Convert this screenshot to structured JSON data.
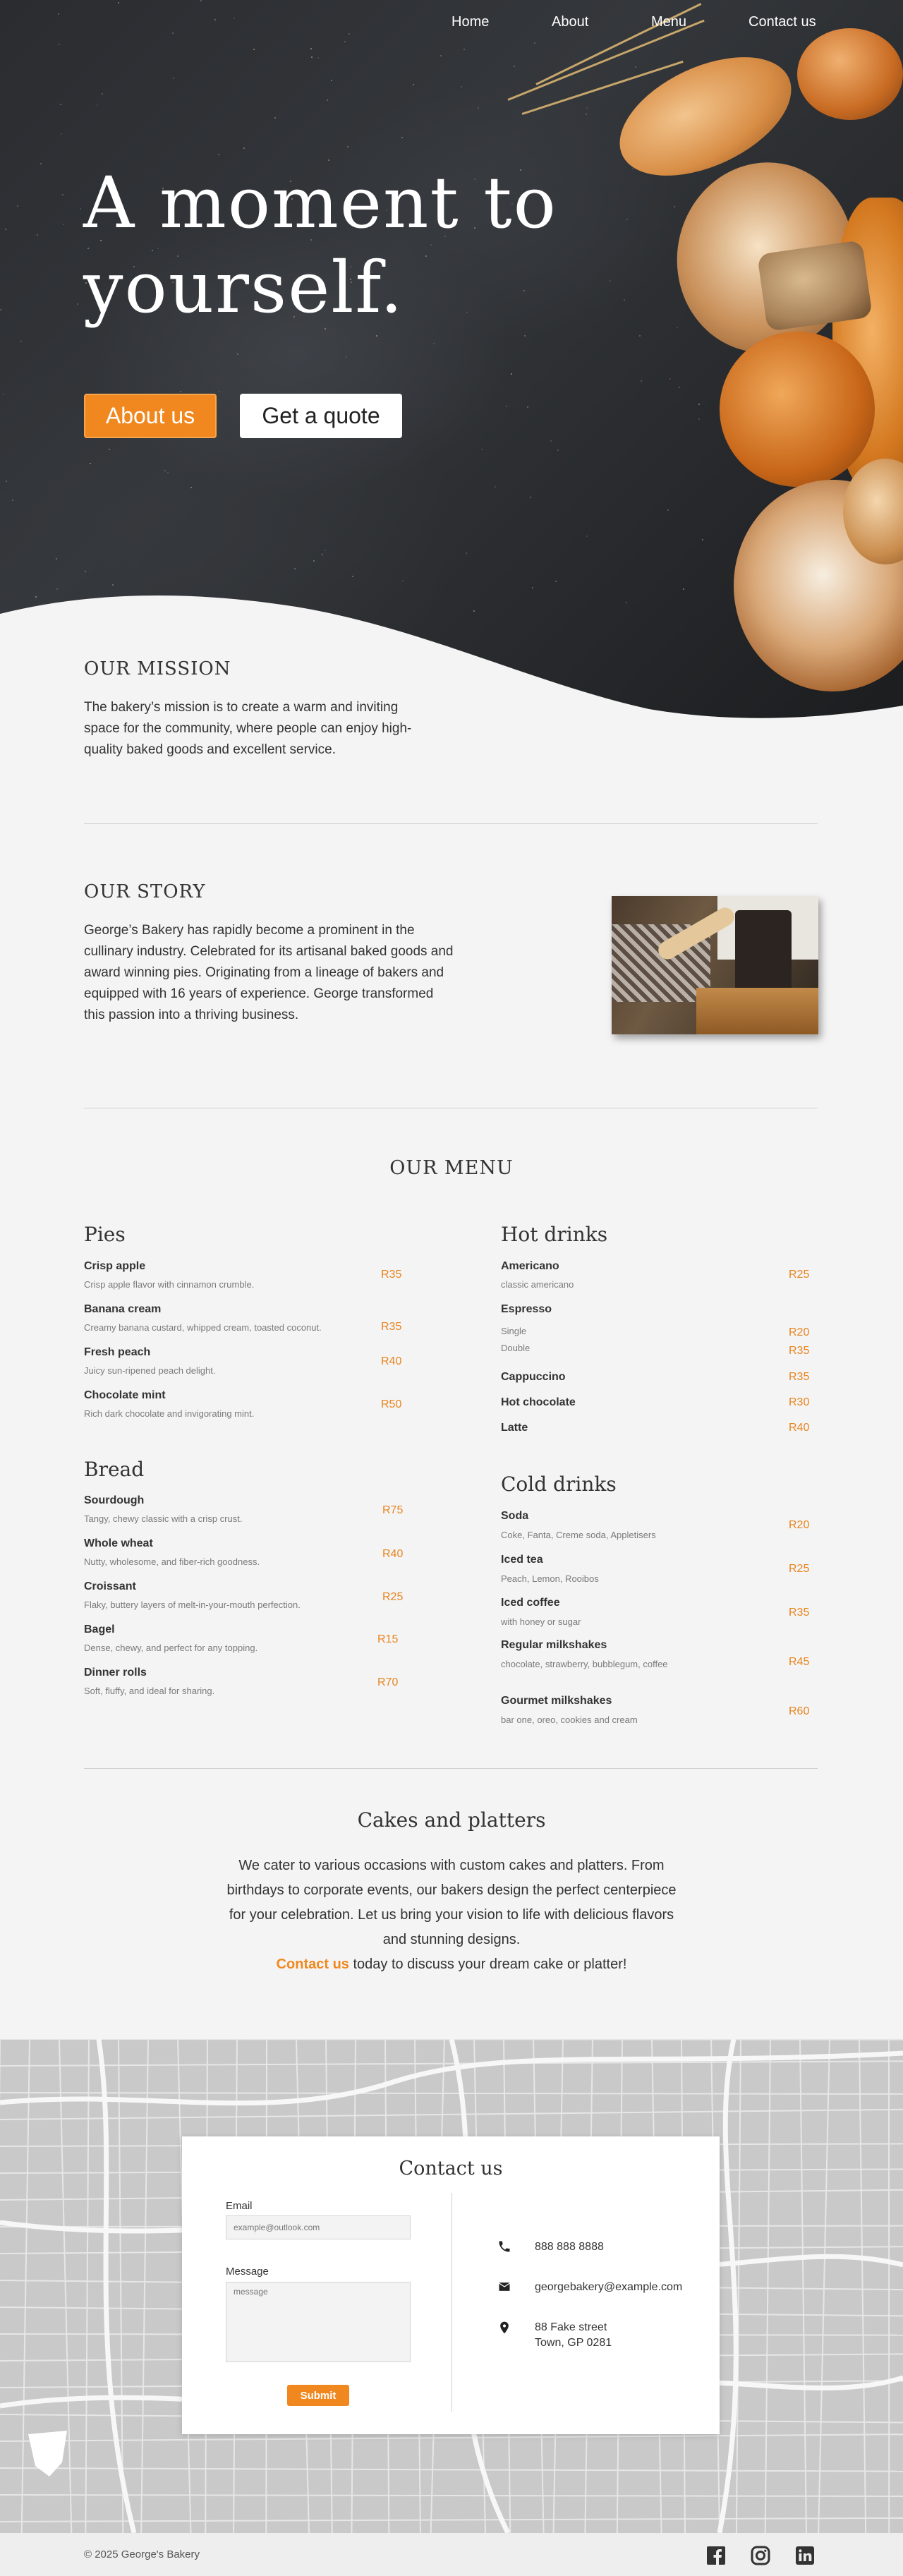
{
  "nav": {
    "items": [
      {
        "label": "Home"
      },
      {
        "label": "About"
      },
      {
        "label": "Menu"
      },
      {
        "label": "Contact us"
      }
    ]
  },
  "hero": {
    "title_line1": "A moment to",
    "title_line2": "yourself.",
    "primary_button": "About us",
    "secondary_button": "Get a quote"
  },
  "mission": {
    "heading": "OUR MISSION",
    "text": "The bakery’s mission is to create a warm and inviting space for the community, where people can enjoy high-quality baked goods and excellent service."
  },
  "story": {
    "heading": "OUR STORY",
    "text": "George’s Bakery has rapidly become a prominent in the cullinary industry. Celebrated for its artisanal baked goods and award winning pies. Originating from a lineage of bakers and equipped with 16 years of experience. George transformed this passion into a thriving business."
  },
  "menu": {
    "title": "OUR MENU",
    "pies": {
      "title": "Pies",
      "items": [
        {
          "name": "Crisp apple",
          "desc": "Crisp apple flavor with cinnamon crumble.",
          "price": "R35"
        },
        {
          "name": "Banana cream",
          "desc": "Creamy banana custard, whipped cream, toasted coconut.",
          "price": "R35"
        },
        {
          "name": "Fresh peach",
          "desc": "Juicy sun-ripened peach delight.",
          "price": "R40"
        },
        {
          "name": "Chocolate mint",
          "desc": "Rich dark chocolate and invigorating mint.",
          "price": "R50"
        }
      ]
    },
    "bread": {
      "title": "Bread",
      "items": [
        {
          "name": "Sourdough",
          "desc": "Tangy, chewy classic with a crisp crust.",
          "price": "R75"
        },
        {
          "name": "Whole wheat",
          "desc": "Nutty, wholesome, and fiber-rich goodness.",
          "price": "R40"
        },
        {
          "name": "Croissant",
          "desc": "Flaky, buttery layers of melt-in-your-mouth perfection.",
          "price": "R25"
        },
        {
          "name": "Bagel",
          "desc": "Dense, chewy, and perfect for any topping.",
          "price": "R15"
        },
        {
          "name": "Dinner rolls",
          "desc": "Soft, fluffy, and ideal for sharing.",
          "price": "R70"
        }
      ]
    },
    "hot": {
      "title": "Hot drinks",
      "americano": {
        "name": "Americano",
        "desc": "classic americano",
        "price": "R25"
      },
      "espresso": {
        "name": "Espresso",
        "single": "Single",
        "single_price": "R20",
        "double": "Double",
        "double_price": "R35"
      },
      "cappuccino": {
        "name": "Cappuccino",
        "price": "R35"
      },
      "hot_chocolate": {
        "name": "Hot chocolate",
        "price": "R30"
      },
      "latte": {
        "name": "Latte",
        "price": "R40"
      }
    },
    "cold": {
      "title": "Cold drinks",
      "items": [
        {
          "name": "Soda",
          "desc": "Coke, Fanta, Creme soda, Appletisers",
          "price": "R20"
        },
        {
          "name": "Iced tea",
          "desc": "Peach, Lemon, Rooibos",
          "price": "R25"
        },
        {
          "name": "Iced coffee",
          "desc": "with honey or sugar",
          "price": "R35"
        },
        {
          "name": "Regular milkshakes",
          "desc": "chocolate, strawberry, bubblegum, coffee",
          "price": "R45"
        },
        {
          "name": "Gourmet milkshakes",
          "desc": "bar one, oreo, cookies and cream",
          "price": "R60"
        }
      ]
    }
  },
  "cakes": {
    "title": "Cakes and platters",
    "text": "We cater to various occasions with custom cakes and platters. From birthdays to corporate events, our bakers design the perfect centerpiece for your celebration. Let us bring your vision to life with delicious flavors and stunning designs.",
    "link": "Contact us",
    "link_suffix": " today to discuss your dream cake or platter!"
  },
  "contact": {
    "title": "Contact us",
    "email_label": "Email",
    "email_placeholder": "example@outlook.com",
    "message_label": "Message",
    "message_placeholder": "message",
    "submit": "Submit",
    "phone": "888 888 8888",
    "email": "georgebakery@example.com",
    "address_line1": "88 Fake street",
    "address_line2": "Town, GP 0281"
  },
  "footer": {
    "copyright": "© 2025 George's Bakery",
    "social": [
      "facebook-icon",
      "instagram-icon",
      "linkedin-icon"
    ]
  },
  "colors": {
    "accent": "#f0881f",
    "background": "#f4f4f4",
    "text": "#333333"
  }
}
